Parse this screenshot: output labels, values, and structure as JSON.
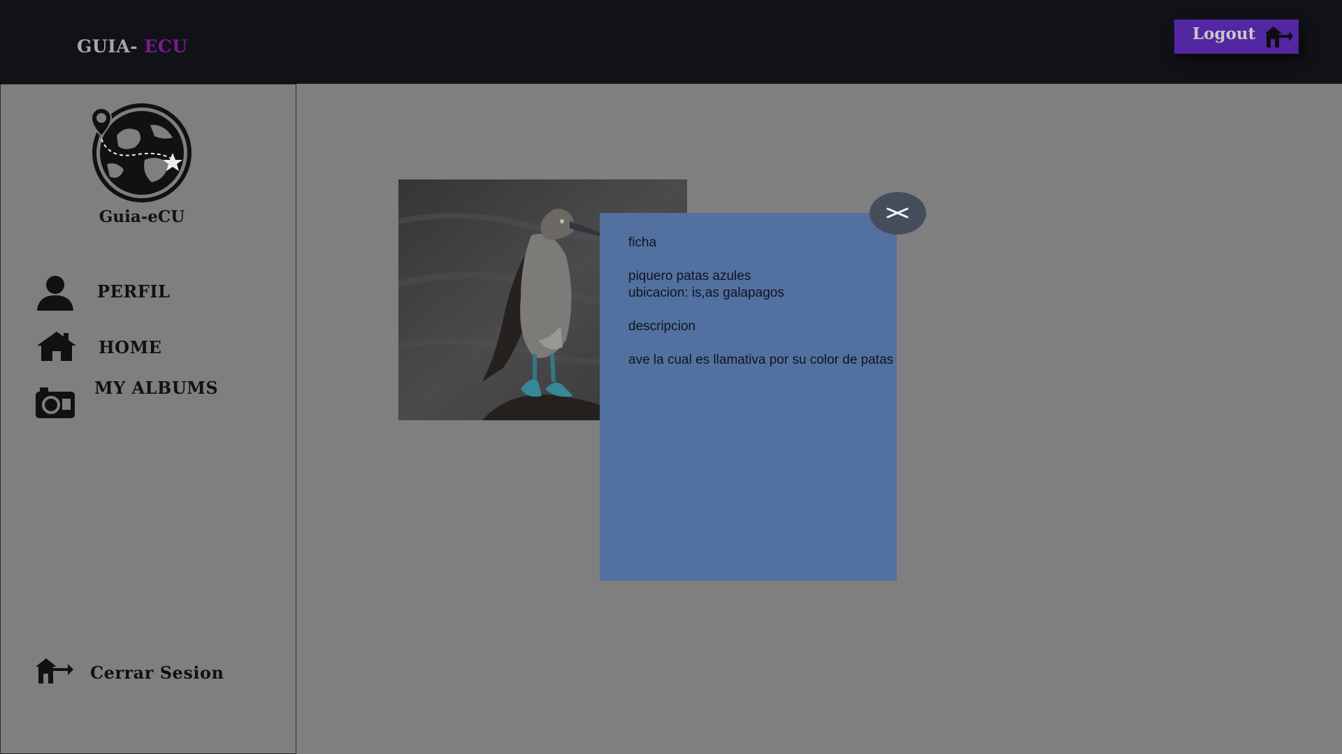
{
  "header": {
    "brand_part1": "GUIA- ",
    "brand_part2": "ECU",
    "logout_label": "Logout"
  },
  "sidebar": {
    "logo_text": "Guia-eCU",
    "items": [
      {
        "label": "PERFIL",
        "icon": "user-icon"
      },
      {
        "label": "HOME",
        "icon": "home-icon"
      },
      {
        "label": "MY ALBUMS",
        "icon": "camera-icon"
      }
    ],
    "logout_label": "Cerrar Sesion"
  },
  "modal": {
    "heading": "ficha",
    "name": "piquero patas azules",
    "location": "ubicacion: is,as galapagos",
    "description_heading": "descripcion",
    "description": "ave la cual es llamativa por su color de patas"
  },
  "colors": {
    "topbar": "#101218",
    "accent": "#7a1b8c",
    "logout_button": "#5326a2",
    "modal_background": "#5371a0",
    "overlay": "#7f7f7f"
  }
}
